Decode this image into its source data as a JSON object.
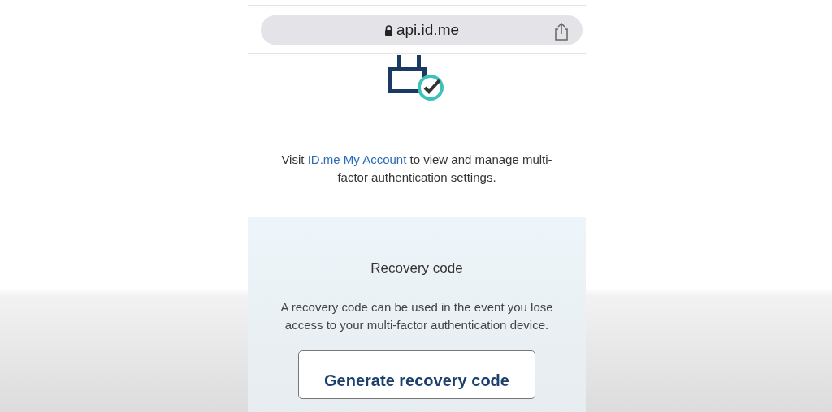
{
  "address_bar": {
    "url": "api.id.me",
    "secure": true
  },
  "intro": {
    "before": "Visit ",
    "link": "ID.me My Account",
    "after": " to view and manage multi-factor authentication settings."
  },
  "recovery_card": {
    "title": "Recovery code",
    "description": "A recovery code can be used in the event you lose access to your multi-factor authentication device.",
    "button": "Generate recovery code"
  }
}
